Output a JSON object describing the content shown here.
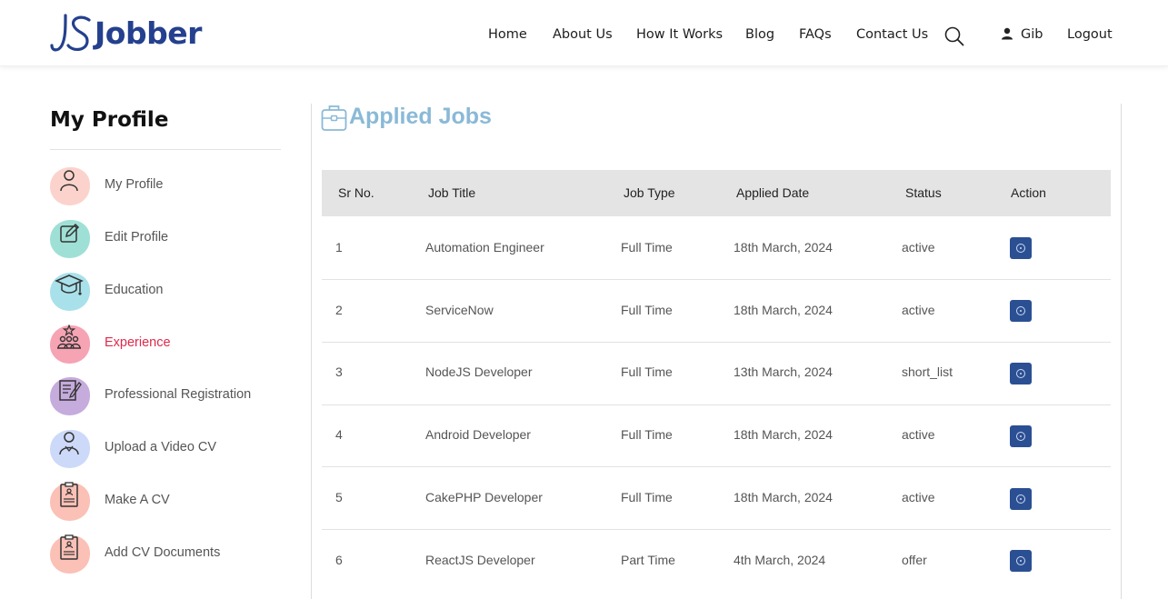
{
  "brand": {
    "mark": "JS",
    "name": "Jobber",
    "color": "#24408e"
  },
  "nav": {
    "items": [
      {
        "label": "Home"
      },
      {
        "label": "About Us"
      },
      {
        "label": "How It Works"
      },
      {
        "label": "Blog"
      },
      {
        "label": "FAQs"
      },
      {
        "label": "Contact Us"
      }
    ],
    "search_icon": "search-icon",
    "user_icon": "user-icon",
    "user_name": "Gib",
    "logout": "Logout"
  },
  "sidebar": {
    "title": "My Profile",
    "items": [
      {
        "label": "My Profile",
        "icon": "user-icon",
        "blob": "#fbd3cc",
        "active": false
      },
      {
        "label": "Edit Profile",
        "icon": "edit-icon",
        "blob": "#9fe0d6",
        "active": false
      },
      {
        "label": "Education",
        "icon": "graduation-cap-icon",
        "blob": "#a9e1ea",
        "active": false
      },
      {
        "label": "Experience",
        "icon": "team-star-icon",
        "blob": "#f6a3b3",
        "active": true
      },
      {
        "label": "Professional Registration",
        "icon": "registration-form-icon",
        "blob": "#c6abdd",
        "active": false
      },
      {
        "label": "Upload a Video CV",
        "icon": "person-video-icon",
        "blob": "#cdd9f8",
        "active": false
      },
      {
        "label": "Make A CV",
        "icon": "cv-document-icon",
        "blob": "#fbc0b6",
        "active": false
      },
      {
        "label": "Add CV Documents",
        "icon": "cv-documents-icon",
        "blob": "#fbc0b6",
        "active": false
      }
    ],
    "active_color": "#e0294a"
  },
  "main": {
    "title": "Applied Jobs",
    "title_icon": "briefcase-icon",
    "title_color": "#8ab9d7",
    "table": {
      "headers": [
        "Sr No.",
        "Job Title",
        "Job Type",
        "Applied Date",
        "Status",
        "Action"
      ],
      "rows": [
        {
          "sr": "1",
          "title": "Automation Engineer",
          "type": "Full Time",
          "date": "18th March, 2024",
          "status": "active"
        },
        {
          "sr": "2",
          "title": "ServiceNow",
          "type": "Full Time",
          "date": "18th March, 2024",
          "status": "active"
        },
        {
          "sr": "3",
          "title": "NodeJS Developer",
          "type": "Full Time",
          "date": "13th March, 2024",
          "status": "short_list"
        },
        {
          "sr": "4",
          "title": "Android Developer",
          "type": "Full Time",
          "date": "18th March, 2024",
          "status": "active"
        },
        {
          "sr": "5",
          "title": "CakePHP Developer",
          "type": "Full Time",
          "date": "18th March, 2024",
          "status": "active"
        },
        {
          "sr": "6",
          "title": "ReactJS Developer",
          "type": "Part Time",
          "date": "4th March, 2024",
          "status": "offer"
        }
      ],
      "action_icon": "view-icon",
      "action_color": "#2b4f93"
    }
  }
}
